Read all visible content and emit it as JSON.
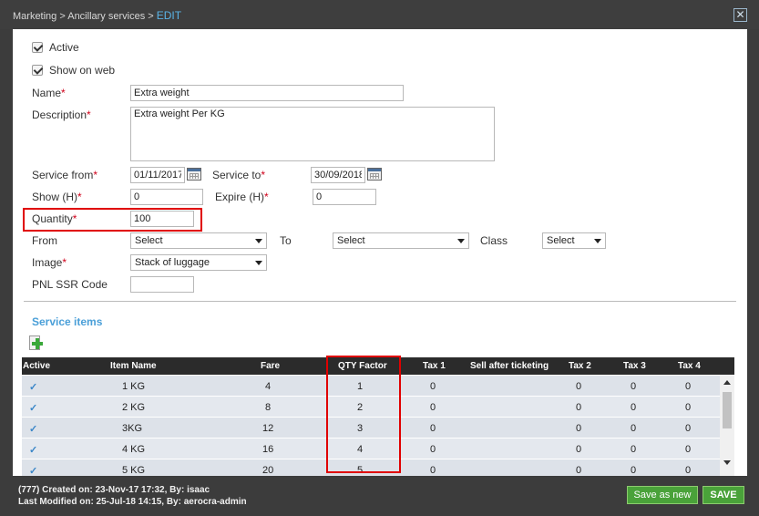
{
  "breadcrumb": {
    "path": "Marketing > Ancillary services > ",
    "current": "EDIT"
  },
  "close_icon_glyph": "✕",
  "form": {
    "active_label": "Active",
    "show_on_web_label": "Show on web",
    "name_label": "Name",
    "name_value": "Extra weight",
    "description_label": "Description",
    "description_value": "Extra weight Per KG",
    "service_from_label": "Service from",
    "service_from_value": "01/11/2017",
    "service_to_label": "Service to",
    "service_to_value": "30/09/2018",
    "show_label": "Show (H)",
    "show_value": "0",
    "expire_label": "Expire (H)",
    "expire_value": "0",
    "quantity_label": "Quantity",
    "quantity_value": "100",
    "from_label": "From",
    "from_value": "Select",
    "to_label": "To",
    "to_value": "Select",
    "class_label": "Class",
    "class_value": "Select",
    "image_label": "Image",
    "image_value": "Stack of luggage",
    "pnl_label": "PNL SSR Code",
    "pnl_value": "",
    "required_mark": "*"
  },
  "service_items": {
    "title": "Service items",
    "columns": [
      "Active",
      "Item Name",
      "Fare",
      "QTY Factor",
      "Tax 1",
      "Sell after ticketing",
      "Tax 2",
      "Tax 3",
      "Tax 4"
    ],
    "rows": [
      {
        "active": "✓",
        "name": "1 KG",
        "fare": "4",
        "qty": "1",
        "tax1": "0",
        "sell": "",
        "tax2": "0",
        "tax3": "0",
        "tax4": "0"
      },
      {
        "active": "✓",
        "name": "2 KG",
        "fare": "8",
        "qty": "2",
        "tax1": "0",
        "sell": "",
        "tax2": "0",
        "tax3": "0",
        "tax4": "0"
      },
      {
        "active": "✓",
        "name": "3KG",
        "fare": "12",
        "qty": "3",
        "tax1": "0",
        "sell": "",
        "tax2": "0",
        "tax3": "0",
        "tax4": "0"
      },
      {
        "active": "✓",
        "name": "4 KG",
        "fare": "16",
        "qty": "4",
        "tax1": "0",
        "sell": "",
        "tax2": "0",
        "tax3": "0",
        "tax4": "0"
      },
      {
        "active": "✓",
        "name": "5 KG",
        "fare": "20",
        "qty": "5",
        "tax1": "0",
        "sell": "",
        "tax2": "0",
        "tax3": "0",
        "tax4": "0"
      }
    ]
  },
  "footer": {
    "created": "(777) Created on: 23-Nov-17 17:32, By: isaac",
    "modified": "Last Modified on: 25-Jul-18 14:15, By: aerocra-admin",
    "save_as_new": "Save as new",
    "save": "SAVE"
  },
  "colors": {
    "accent": "#4a9fd8",
    "highlight": "#e00000",
    "button": "#4aa23a"
  }
}
